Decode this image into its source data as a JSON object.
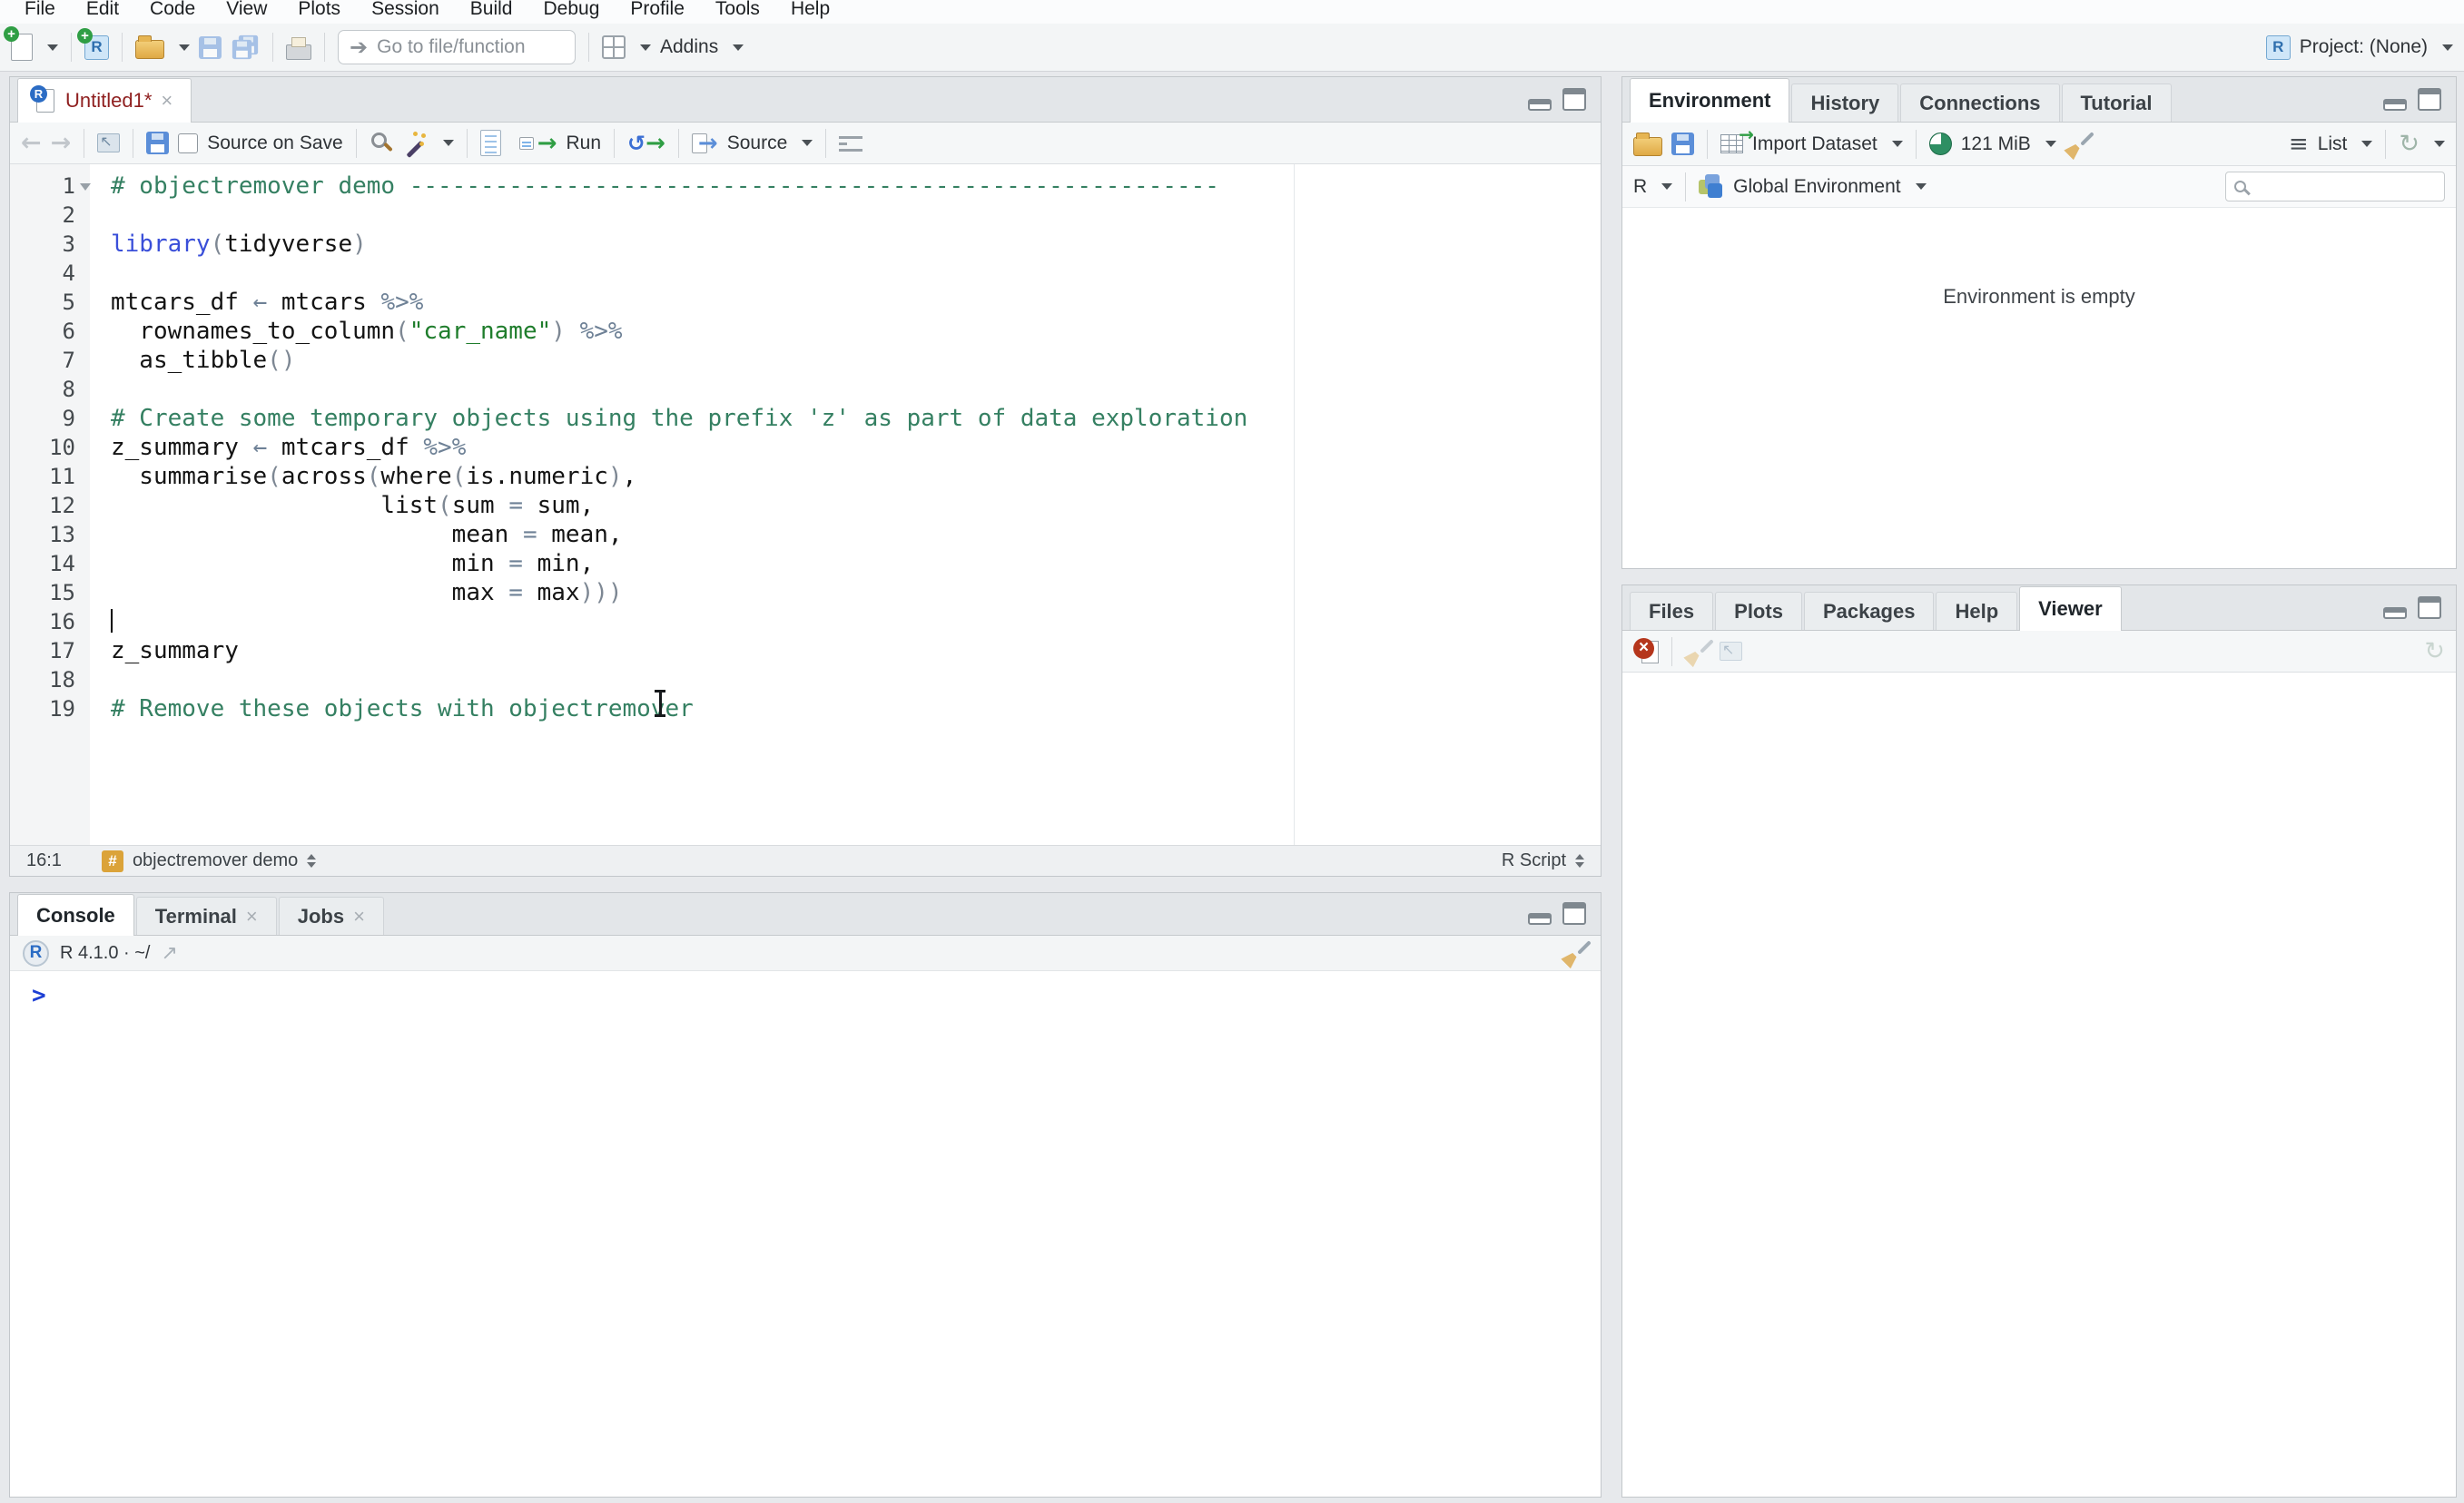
{
  "menu": {
    "items": [
      "File",
      "Edit",
      "Code",
      "View",
      "Plots",
      "Session",
      "Build",
      "Debug",
      "Profile",
      "Tools",
      "Help"
    ]
  },
  "toolbar": {
    "goto_placeholder": "Go to file/function",
    "addins_label": "Addins",
    "project_label": "Project: (None)"
  },
  "source_pane": {
    "tab_title": "Untitled1*",
    "close_label": "×",
    "source_on_save_label": "Source on Save",
    "run_label": "Run",
    "source_label": "Source",
    "status": {
      "cursor_position": "16:1",
      "section_name": "objectremover demo",
      "section_icon": "#",
      "file_type": "R Script"
    }
  },
  "code": {
    "lines": [
      {
        "n": 1,
        "fold": true,
        "tokens": [
          {
            "t": "# objectremover demo ---------------------------------------------------------",
            "c": "com"
          }
        ]
      },
      {
        "n": 2,
        "tokens": []
      },
      {
        "n": 3,
        "tokens": [
          {
            "t": "library",
            "c": "fun"
          },
          {
            "t": "(",
            "c": "par"
          },
          {
            "t": "tidyverse",
            "c": "txt"
          },
          {
            "t": ")",
            "c": "par"
          }
        ]
      },
      {
        "n": 4,
        "tokens": []
      },
      {
        "n": 5,
        "tokens": [
          {
            "t": "mtcars_df ",
            "c": "txt"
          },
          {
            "t": "←",
            "c": "op"
          },
          {
            "t": " mtcars ",
            "c": "txt"
          },
          {
            "t": "%>%",
            "c": "op"
          }
        ]
      },
      {
        "n": 6,
        "tokens": [
          {
            "t": "  rownames_to_column",
            "c": "txt"
          },
          {
            "t": "(",
            "c": "par"
          },
          {
            "t": "\"car_name\"",
            "c": "str"
          },
          {
            "t": ")",
            "c": "par"
          },
          {
            "t": " ",
            "c": "txt"
          },
          {
            "t": "%>%",
            "c": "op"
          }
        ]
      },
      {
        "n": 7,
        "tokens": [
          {
            "t": "  as_tibble",
            "c": "txt"
          },
          {
            "t": "()",
            "c": "par"
          }
        ]
      },
      {
        "n": 8,
        "tokens": []
      },
      {
        "n": 9,
        "tokens": [
          {
            "t": "# Create some temporary objects using the prefix 'z' as part of data exploration",
            "c": "com"
          }
        ]
      },
      {
        "n": 10,
        "tokens": [
          {
            "t": "z_summary ",
            "c": "txt"
          },
          {
            "t": "←",
            "c": "op"
          },
          {
            "t": " mtcars_df ",
            "c": "txt"
          },
          {
            "t": "%>%",
            "c": "op"
          }
        ]
      },
      {
        "n": 11,
        "tokens": [
          {
            "t": "  summarise",
            "c": "txt"
          },
          {
            "t": "(",
            "c": "par"
          },
          {
            "t": "across",
            "c": "txt"
          },
          {
            "t": "(",
            "c": "par"
          },
          {
            "t": "where",
            "c": "txt"
          },
          {
            "t": "(",
            "c": "par"
          },
          {
            "t": "is.numeric",
            "c": "txt"
          },
          {
            "t": ")",
            "c": "par"
          },
          {
            "t": ",",
            "c": "txt"
          }
        ]
      },
      {
        "n": 12,
        "tokens": [
          {
            "t": "                   list",
            "c": "txt"
          },
          {
            "t": "(",
            "c": "par"
          },
          {
            "t": "sum ",
            "c": "txt"
          },
          {
            "t": "=",
            "c": "op"
          },
          {
            "t": " sum,",
            "c": "txt"
          }
        ]
      },
      {
        "n": 13,
        "tokens": [
          {
            "t": "                        mean ",
            "c": "txt"
          },
          {
            "t": "=",
            "c": "op"
          },
          {
            "t": " mean,",
            "c": "txt"
          }
        ]
      },
      {
        "n": 14,
        "tokens": [
          {
            "t": "                        min ",
            "c": "txt"
          },
          {
            "t": "=",
            "c": "op"
          },
          {
            "t": " min,",
            "c": "txt"
          }
        ]
      },
      {
        "n": 15,
        "tokens": [
          {
            "t": "                        max ",
            "c": "txt"
          },
          {
            "t": "=",
            "c": "op"
          },
          {
            "t": " max",
            "c": "txt"
          },
          {
            "t": ")))",
            "c": "par"
          }
        ]
      },
      {
        "n": 16,
        "caret": true,
        "tokens": []
      },
      {
        "n": 17,
        "tokens": [
          {
            "t": "z_summary",
            "c": "txt"
          }
        ]
      },
      {
        "n": 18,
        "tokens": []
      },
      {
        "n": 19,
        "tokens": [
          {
            "t": "# Remove these objects with objectremover",
            "c": "com"
          }
        ]
      }
    ]
  },
  "console_pane": {
    "tabs": [
      "Console",
      "Terminal",
      "Jobs"
    ],
    "close_label": "×",
    "version_line": "R 4.1.0 · ~/",
    "prompt": ">"
  },
  "environment_pane": {
    "tabs": [
      "Environment",
      "History",
      "Connections",
      "Tutorial"
    ],
    "import_label": "Import Dataset",
    "memory_label": "121 MiB",
    "list_label": "List",
    "language_label": "R",
    "scope_label": "Global Environment",
    "empty_message": "Environment is empty"
  },
  "files_pane": {
    "tabs": [
      "Files",
      "Plots",
      "Packages",
      "Help",
      "Viewer"
    ]
  },
  "colors": {
    "comment": "#358062",
    "string": "#1f7d2c",
    "function_call": "#3a4fd9",
    "operator": "#6e8196",
    "unsaved_tab_title": "#8f2020",
    "console_prompt": "#1d3fd4",
    "section_badge": "#dba339",
    "run_arrow_green": "#2f9e44",
    "memory_pie_green": "#2e8f63",
    "toolbar_bg": "#f3f5f6",
    "tabbar_bg": "#e3e6e9"
  }
}
